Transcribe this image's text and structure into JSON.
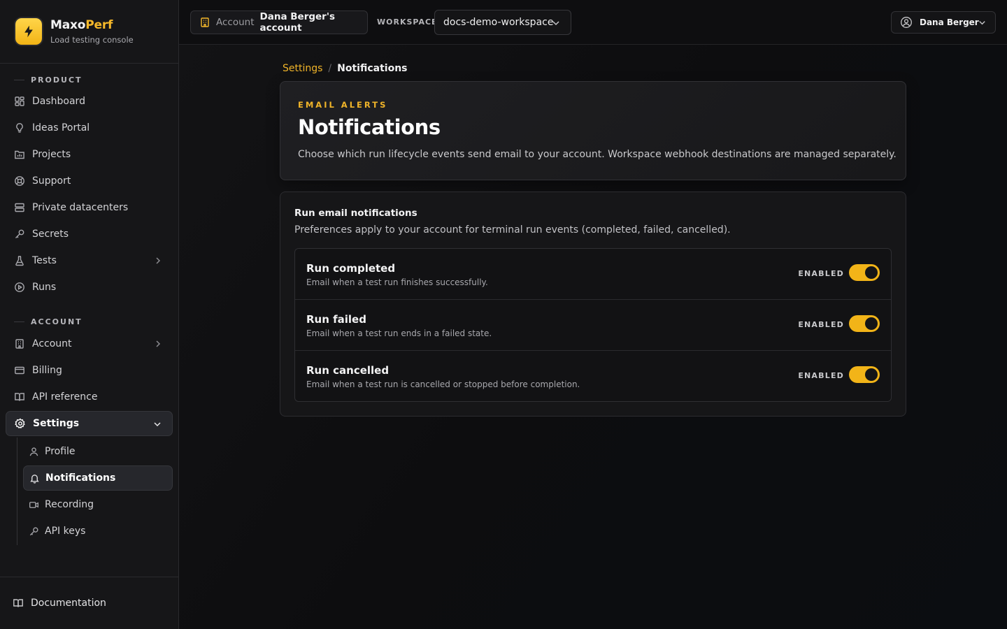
{
  "brand": {
    "name_main": "Maxo",
    "name_accent": "Perf",
    "subtitle": "Load testing console",
    "logo_icon": "bolt-icon",
    "accent_color": "#f5b82a"
  },
  "sidebar": {
    "product_label": "PRODUCT",
    "product_items": [
      {
        "label": "Dashboard",
        "icon": "dashboard-icon"
      },
      {
        "label": "Ideas Portal",
        "icon": "lightbulb-icon"
      },
      {
        "label": "Projects",
        "icon": "folder-chart-icon"
      },
      {
        "label": "Support",
        "icon": "lifebuoy-icon"
      },
      {
        "label": "Private datacenters",
        "icon": "server-icon"
      },
      {
        "label": "Secrets",
        "icon": "key-icon"
      },
      {
        "label": "Tests",
        "icon": "flask-icon"
      },
      {
        "label": "Runs",
        "icon": "play-circle-icon"
      }
    ],
    "account_label": "ACCOUNT",
    "account_items": [
      {
        "label": "Account",
        "icon": "building-icon"
      },
      {
        "label": "Billing",
        "icon": "credit-card-icon"
      },
      {
        "label": "API reference",
        "icon": "book-icon"
      },
      {
        "label": "Settings",
        "icon": "gear-icon"
      }
    ],
    "settings_sub": [
      {
        "label": "Profile",
        "icon": "user-icon"
      },
      {
        "label": "Notifications",
        "icon": "bell-icon"
      },
      {
        "label": "Recording",
        "icon": "video-icon"
      },
      {
        "label": "API keys",
        "icon": "key-icon"
      }
    ],
    "footer_label": "Documentation"
  },
  "topbar": {
    "account_key": "Account",
    "account_value": "Dana Berger's account",
    "workspace_label": "WORKSPACE",
    "workspace_value": "docs-demo-workspace",
    "user_name": "Dana Berger"
  },
  "breadcrumb": {
    "parent": "Settings",
    "separator": "/",
    "current": "Notifications"
  },
  "hero": {
    "eyebrow": "EMAIL ALERTS",
    "title": "Notifications",
    "description": "Choose which run lifecycle events send email to your account. Workspace webhook destinations are managed separately."
  },
  "card": {
    "title": "Run email notifications",
    "subtitle": "Preferences apply to your account for terminal run events (completed, failed, cancelled).",
    "preferences": [
      {
        "name": "Run completed",
        "description": "Email when a test run finishes successfully.",
        "state": "ENABLED",
        "enabled": true
      },
      {
        "name": "Run failed",
        "description": "Email when a test run ends in a failed state.",
        "state": "ENABLED",
        "enabled": true
      },
      {
        "name": "Run cancelled",
        "description": "Email when a test run is cancelled or stopped before completion.",
        "state": "ENABLED",
        "enabled": true
      }
    ]
  },
  "colors": {
    "accent": "#f0b429",
    "toggle_on": "#f2b418",
    "background": "#0c0c0d",
    "sidebar": "#161618"
  }
}
